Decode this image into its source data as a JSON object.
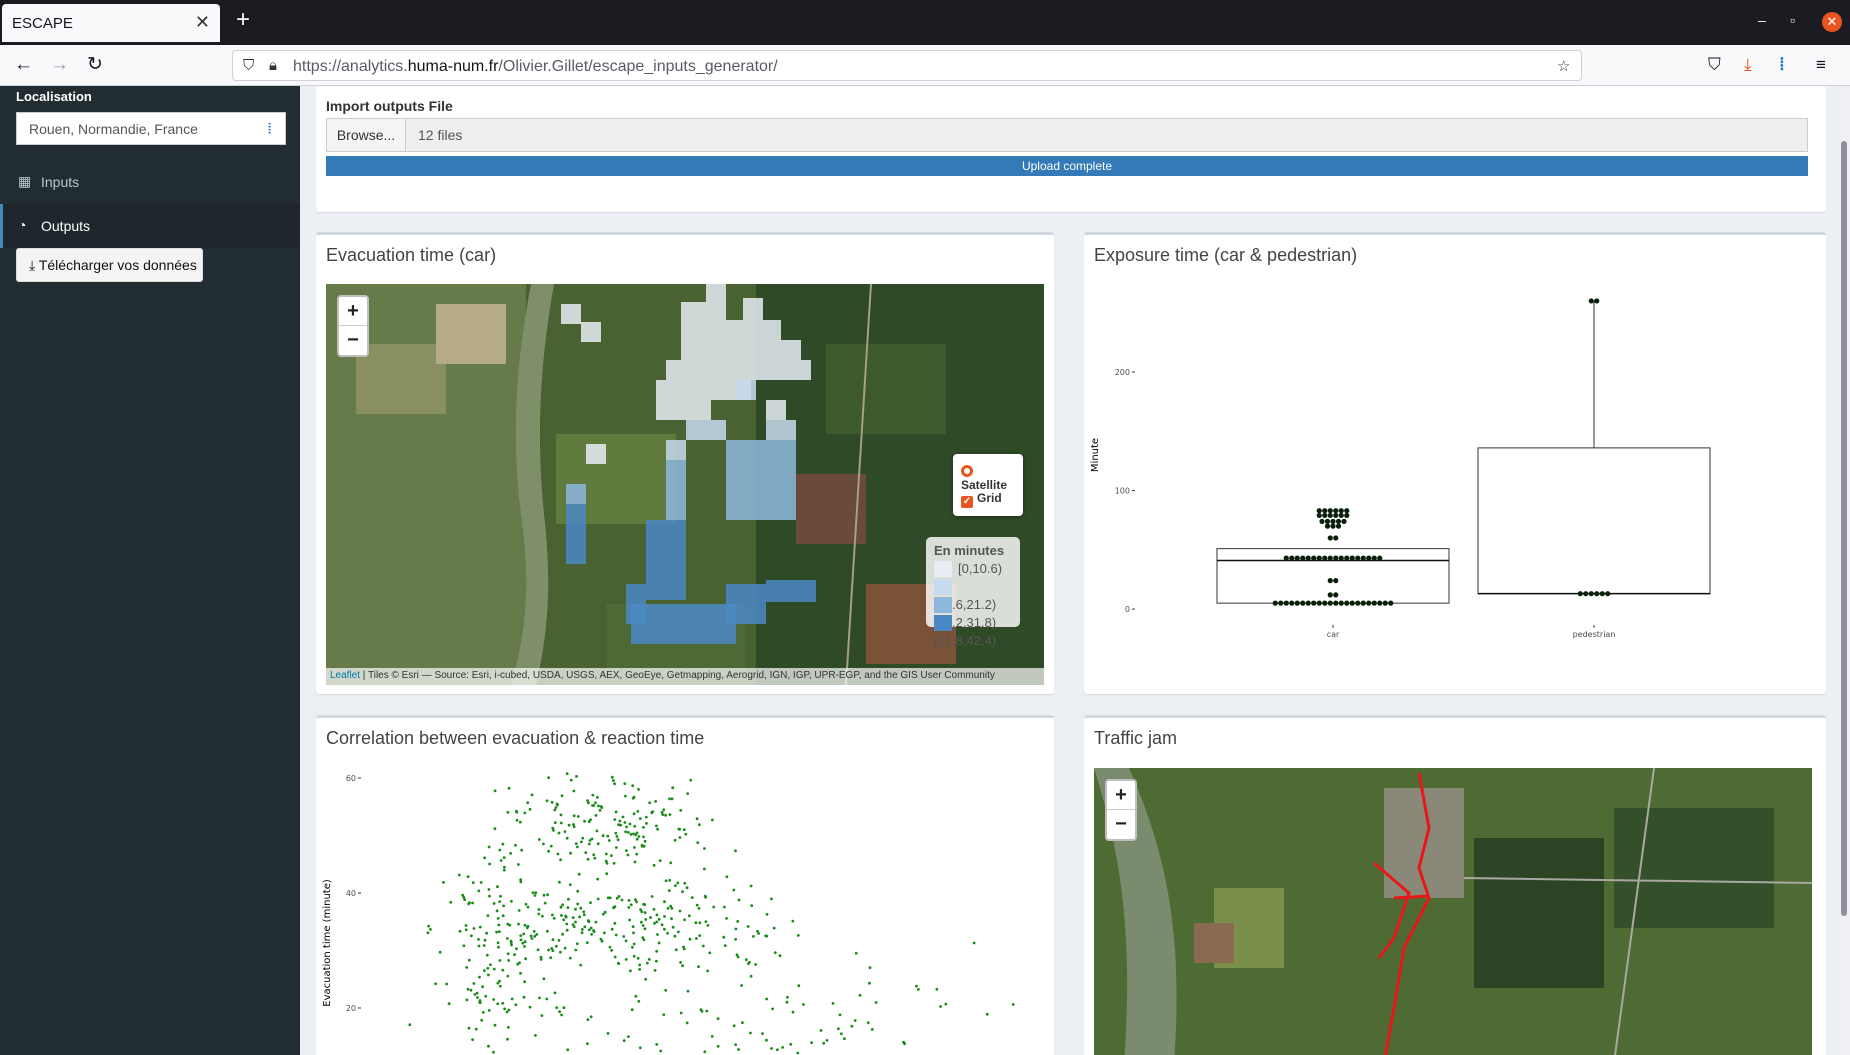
{
  "browser": {
    "tab_title": "ESCAPE",
    "url_prefix": "https://analytics.",
    "url_domain": "huma-num.fr",
    "url_path": "/Olivier.Gillet/escape_inputs_generator/"
  },
  "sidebar": {
    "localisation_label": "Localisation",
    "localisation_value": "Rouen, Normandie, France",
    "items": [
      {
        "label": "Inputs",
        "icon": "grid-icon"
      },
      {
        "label": "Outputs",
        "icon": "dashboard-icon"
      }
    ],
    "download_label": "Télécharger vos données"
  },
  "import": {
    "label": "Import outputs File",
    "browse_label": "Browse...",
    "files_value": "12 files",
    "progress_label": "Upload complete",
    "progress_value": 100
  },
  "panels": {
    "evacuation_car": {
      "title": "Evacuation time (car)",
      "layer_satellite": "Satellite",
      "layer_grid": "Grid",
      "legend_title": "En minutes",
      "legend": [
        {
          "label": "[0,10.6)",
          "color": "#e6edf5"
        },
        {
          "label": "[10.6,21.2)",
          "color": "#c6dbef"
        },
        {
          "label": "[21.2,31.8)",
          "color": "#8db8de"
        },
        {
          "label": "[31.8,42.4)",
          "color": "#4a88c5"
        }
      ],
      "attribution_link": "Leaflet",
      "attribution_text": " | Tiles © Esri — Source: Esri, i-cubed, USDA, USGS, AEX, GeoEye, Getmapping, Aerogrid, IGN, IGP, UPR-EGP, and the GIS User Community"
    },
    "exposure": {
      "title": "Exposure time (car & pedestrian)"
    },
    "correlation": {
      "title": "Correlation between evacuation & reaction time"
    },
    "traffic": {
      "title": "Traffic jam"
    }
  },
  "zoom": {
    "in": "+",
    "out": "−"
  },
  "chart_data": [
    {
      "type": "box",
      "title": "Exposure time (car & pedestrian)",
      "xlabel": "",
      "ylabel": "Minute",
      "categories": [
        "car",
        "pedestrian"
      ],
      "y_ticks": [
        0,
        100,
        200
      ],
      "ylim": [
        -5,
        265
      ],
      "boxes": [
        {
          "category": "car",
          "min": 5,
          "q1": 5,
          "median": 41,
          "q3": 51,
          "max": 51
        },
        {
          "category": "pedestrian",
          "min": 13,
          "q1": 13,
          "median": 13,
          "q3": 136,
          "max": 260
        }
      ],
      "points": [
        {
          "category": "car",
          "values": [
            5,
            5,
            5,
            5,
            5,
            5,
            5,
            5,
            5,
            5,
            5,
            5,
            5,
            5,
            5,
            5,
            5,
            5,
            5,
            5,
            5,
            5,
            12,
            12,
            24,
            24,
            43,
            43,
            43,
            43,
            43,
            43,
            43,
            43,
            43,
            43,
            43,
            43,
            43,
            43,
            43,
            43,
            43,
            43,
            60,
            60,
            70,
            70,
            70,
            74,
            74,
            74,
            74,
            74,
            79,
            79,
            79,
            79,
            79,
            79,
            83,
            83,
            83,
            83,
            83,
            83
          ]
        },
        {
          "category": "pedestrian",
          "values": [
            13,
            13,
            13,
            13,
            13,
            13,
            260,
            260
          ]
        }
      ]
    },
    {
      "type": "scatter",
      "title": "Correlation between evacuation & reaction time",
      "ylabel": "Evacuation time  (minute)",
      "y_ticks": [
        20,
        40,
        60
      ],
      "color": "#1a8a1a"
    }
  ]
}
